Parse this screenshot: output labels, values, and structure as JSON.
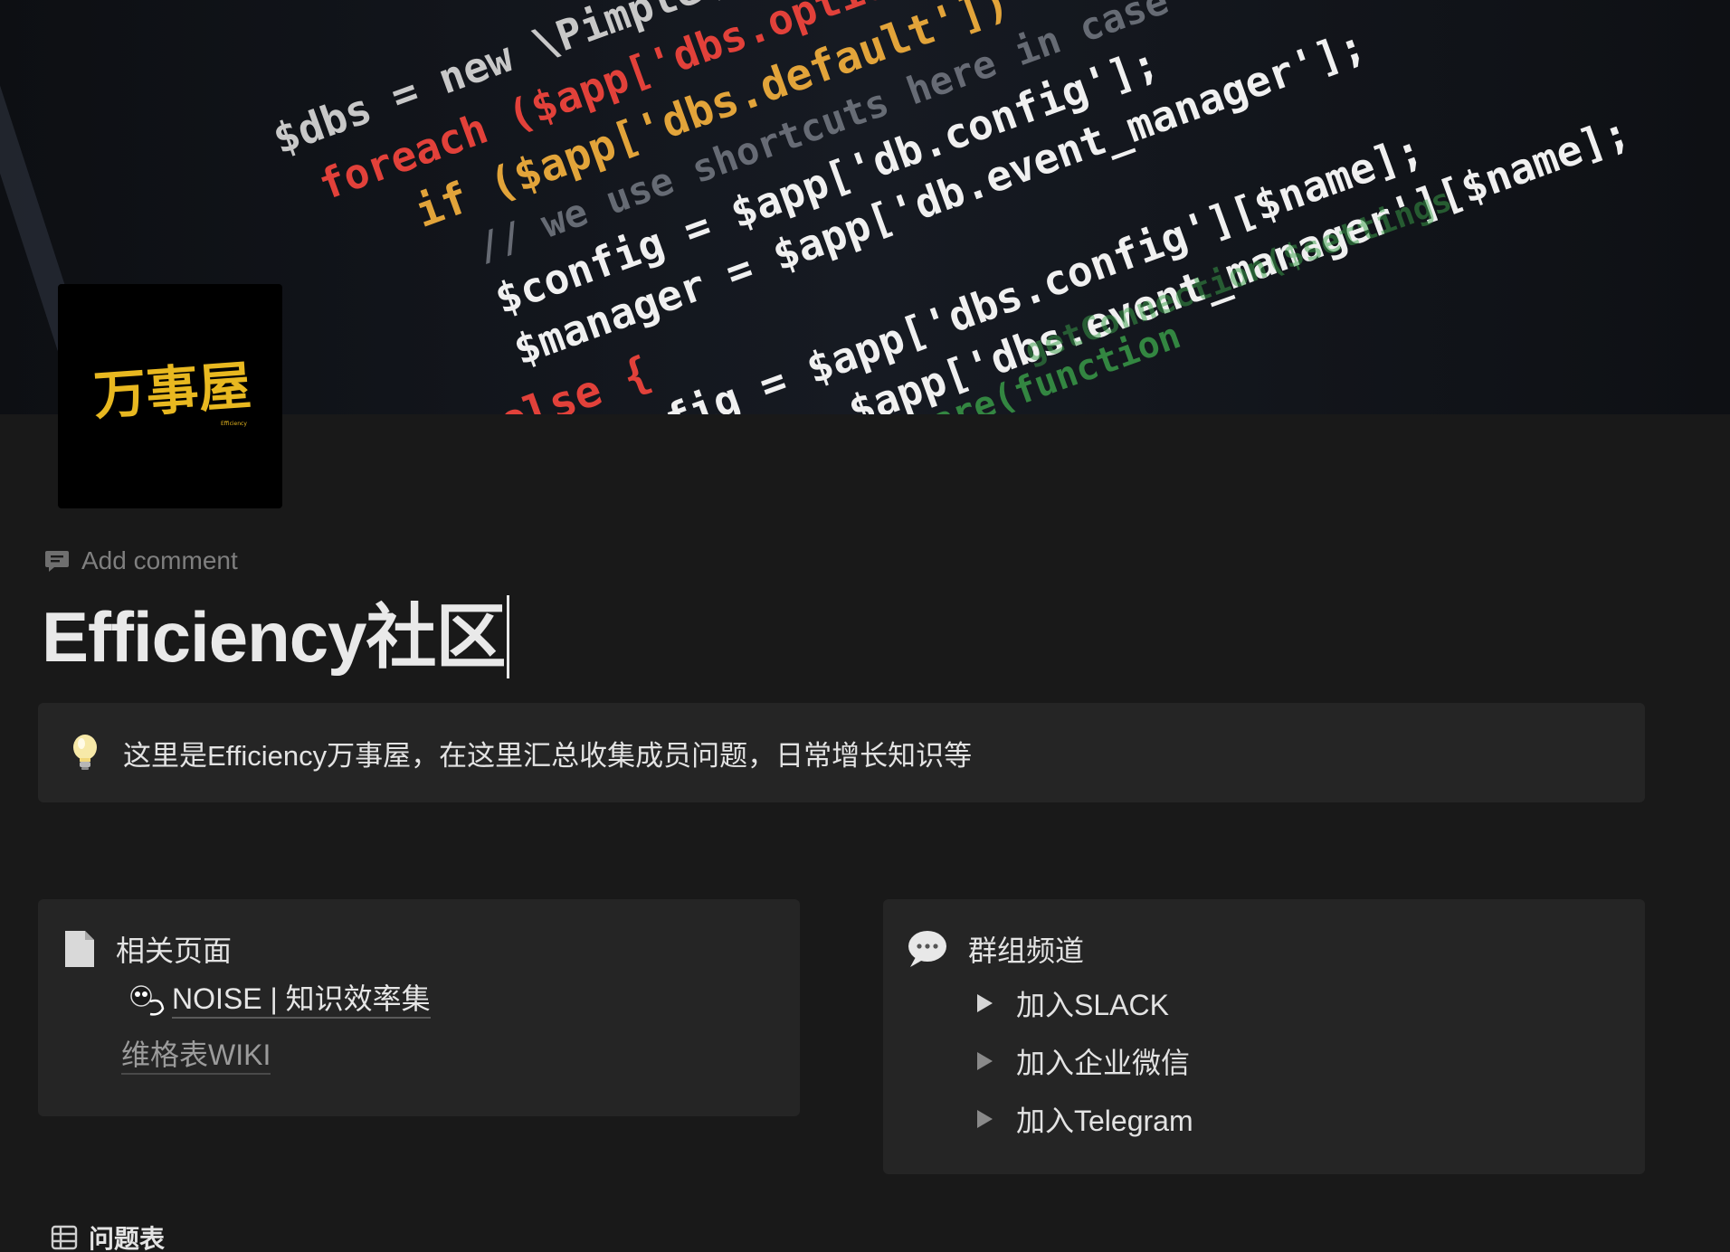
{
  "cover": {
    "code_lines": [
      "$dbs = new \\Pimple(",
      "foreach ($app['dbs.options'] ===",
      "if ($app['dbs.default'])",
      "// we use shortcuts here in case",
      "$config = $app['db.config'];",
      "$manager = $app['db.event_manager'];",
      "} else {",
      "$config = $app['dbs.config'][$name];",
      "$manager = $app['dbs.event_manager'][$name];",
      "->share(function",
      "getConnection($settings"
    ]
  },
  "page_icon": {
    "logo_text": "万事屋",
    "logo_subtext": "Efficiency"
  },
  "add_comment": {
    "label": "Add comment",
    "icon": "comment-icon"
  },
  "title": "Efficiency社区",
  "callout": {
    "icon": "lightbulb-icon",
    "text": "这里是Efficiency万事屋，在这里汇总收集成员问题，日常增长知识等"
  },
  "related": {
    "icon": "page-icon",
    "heading": "相关页面",
    "links": [
      {
        "label": "NOISE | 知识效率集",
        "icon": "noise-emoji-icon"
      },
      {
        "label": "维格表WIKI"
      }
    ]
  },
  "channels": {
    "icon": "speech-bubble-icon",
    "heading": "群组频道",
    "items": [
      {
        "label": "加入SLACK"
      },
      {
        "label": "加入企业微信"
      },
      {
        "label": "加入Telegram"
      }
    ]
  },
  "database": {
    "icon": "table-icon",
    "label": "问题表"
  },
  "colors": {
    "background": "#191919",
    "block": "#252525",
    "text": "#e3e3e3",
    "muted": "#7f7f7f",
    "logo_gold": "#e8b820"
  }
}
